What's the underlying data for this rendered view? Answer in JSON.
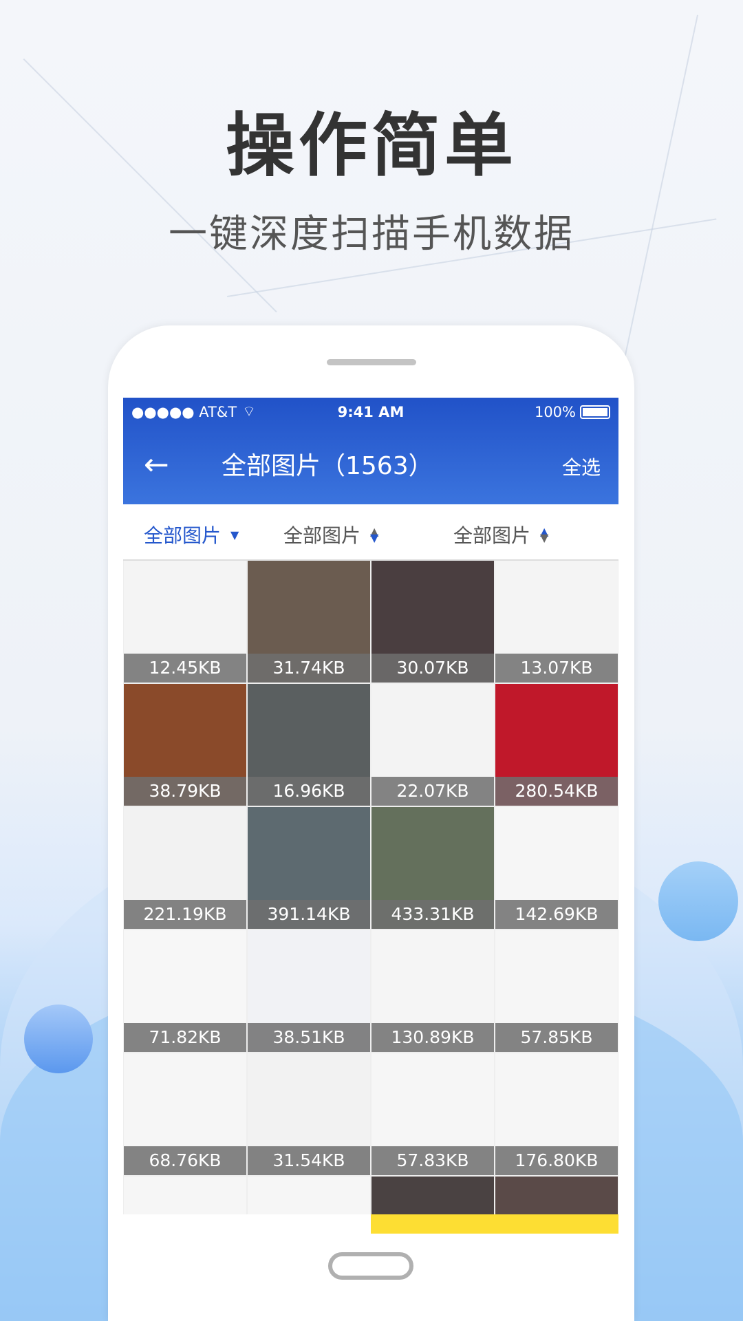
{
  "promo": {
    "headline": "操作简单",
    "subtitle": "一键深度扫描手机数据"
  },
  "status_bar": {
    "carrier": "●●●●● AT&T",
    "time": "9:41 AM",
    "battery": "100%",
    "battery_level": 1.0
  },
  "nav": {
    "back_icon": "arrow-left-icon",
    "title": "全部图片（1563）",
    "select_all": "全选"
  },
  "filters": [
    {
      "label": "全部图片",
      "icon": "caret-down-icon",
      "active": true
    },
    {
      "label": "全部图片",
      "icon": "sort-icon",
      "active": false
    },
    {
      "label": "全部图片",
      "icon": "sort-icon",
      "active": false
    }
  ],
  "colors": {
    "accent": "#2457cc",
    "highlight": "#fdde33"
  },
  "tiles": [
    {
      "size": "12.45KB",
      "bg": "#f4f4f4"
    },
    {
      "size": "31.74KB",
      "bg": "#6b5c50"
    },
    {
      "size": "30.07KB",
      "bg": "#4a3e40"
    },
    {
      "size": "13.07KB",
      "bg": "#f4f4f4"
    },
    {
      "size": "38.79KB",
      "bg": "#8a4a2a"
    },
    {
      "size": "16.96KB",
      "bg": "#5a5f60"
    },
    {
      "size": "22.07KB",
      "bg": "#f3f3f3"
    },
    {
      "size": "280.54KB",
      "bg": "#c0182a"
    },
    {
      "size": "221.19KB",
      "bg": "#f2f2f2"
    },
    {
      "size": "391.14KB",
      "bg": "#5d6a70"
    },
    {
      "size": "433.31KB",
      "bg": "#64705c"
    },
    {
      "size": "142.69KB",
      "bg": "#f6f6f6"
    },
    {
      "size": "71.82KB",
      "bg": "#f7f7f7"
    },
    {
      "size": "38.51KB",
      "bg": "#f1f2f5"
    },
    {
      "size": "130.89KB",
      "bg": "#f5f5f5"
    },
    {
      "size": "57.85KB",
      "bg": "#f6f6f6"
    },
    {
      "size": "68.76KB",
      "bg": "#f6f6f6"
    },
    {
      "size": "31.54KB",
      "bg": "#f2f2f2"
    },
    {
      "size": "57.83KB",
      "bg": "#f6f6f6"
    },
    {
      "size": "176.80KB",
      "bg": "#f6f6f6"
    },
    {
      "size": "",
      "bg": "#f6f6f6"
    },
    {
      "size": "",
      "bg": "#f6f6f6"
    },
    {
      "size": "",
      "bg": "#4a4242"
    },
    {
      "size": "",
      "bg": "#5a4a48"
    }
  ]
}
